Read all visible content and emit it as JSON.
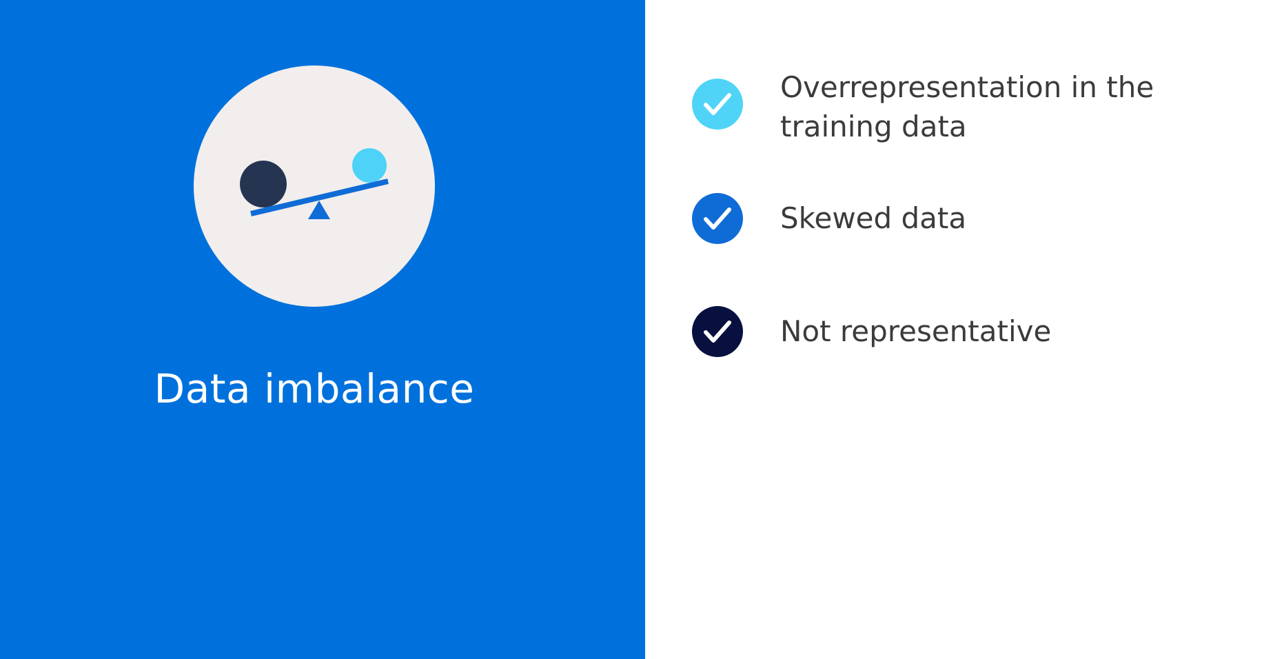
{
  "title": "Data imbalance",
  "bullets": [
    {
      "text": "Overrepresentation in the training data",
      "check_color": "#4fd4f7"
    },
    {
      "text": "Skewed data",
      "check_color": "#0f6cd6"
    },
    {
      "text": "Not representative",
      "check_color": "#07103f"
    }
  ],
  "colors": {
    "left_panel": "#0071dc",
    "circle": "#f2eeed",
    "dark_ball": "#253551",
    "light_ball": "#4ed2f7",
    "seesaw": "#0f6cd6",
    "text": "#3b3b3b"
  },
  "icons": [
    "seesaw-illustration",
    "check-icon"
  ]
}
